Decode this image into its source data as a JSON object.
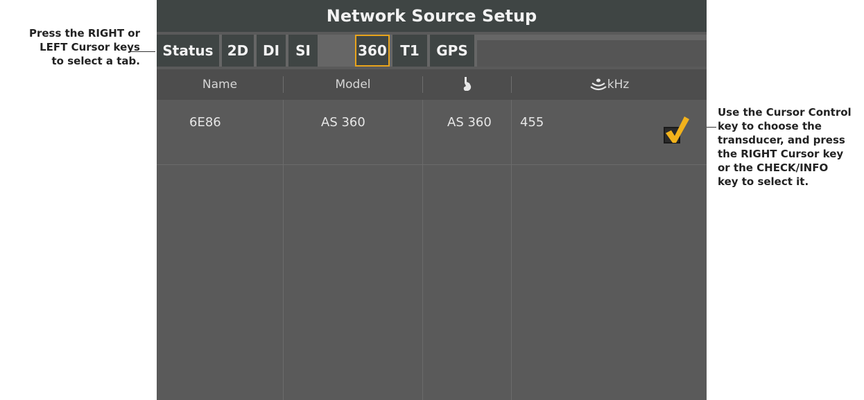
{
  "callouts": {
    "left": [
      "Press the RIGHT or",
      "LEFT Cursor keys",
      "to select a tab."
    ],
    "right": [
      "Use the Cursor Control",
      "key to choose the",
      "transducer, and press",
      "the RIGHT Cursor key",
      "or the CHECK/INFO",
      "key to select it."
    ]
  },
  "screen": {
    "title": "Network Source Setup",
    "tabs": [
      "Status",
      "2D",
      "DI",
      "SI",
      "360",
      "T1",
      "GPS"
    ],
    "active_tab": "360",
    "columns": [
      "Name",
      "Model",
      "",
      "kHz"
    ],
    "column_icons": [
      "transducer-icon",
      "sonar-icon"
    ],
    "rows": [
      {
        "name": "6E86",
        "model": "AS 360",
        "transducer": "AS 360",
        "khz": "455",
        "selected": true
      }
    ]
  },
  "colors": {
    "accent": "#e8a41c",
    "title_bg": "#3f4544",
    "body_bg": "#5a5a5a"
  }
}
